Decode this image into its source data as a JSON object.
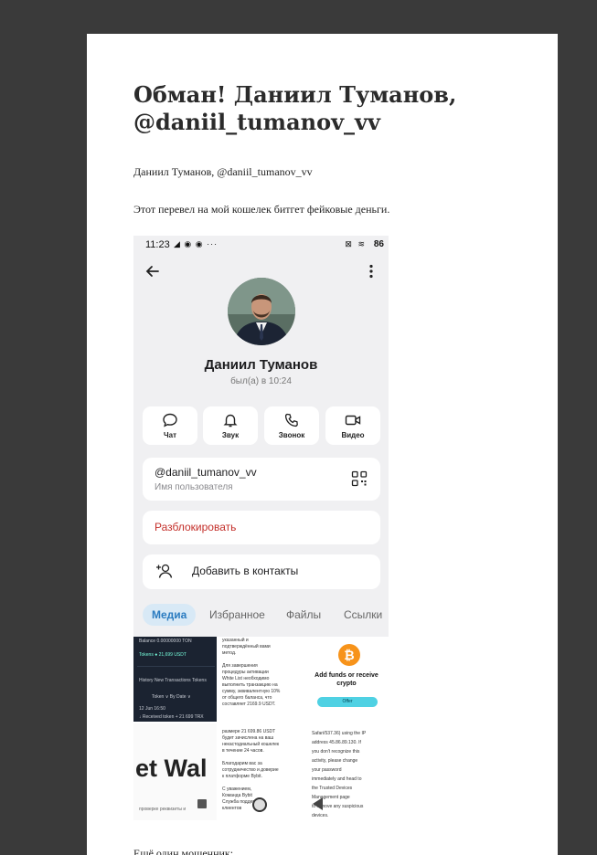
{
  "article": {
    "title": "Обман! Даниил Туманов, @daniil_tumanov_vv",
    "subtitle_line": "Даниил Туманов, @daniil_tumanov_vv",
    "description": "Этот перевел на мой кошелек битгет фейковые деньги.",
    "next_line": "Ещё один мошенник:"
  },
  "screenshot": {
    "status_time": "11:23",
    "status_left_icons": "◢ ◉ ◉ ···",
    "status_right_icons": "⊠ ≋",
    "battery": "86",
    "contact_name": "Даниил Туманов",
    "last_seen": "был(а) в 10:24",
    "actions": [
      {
        "label": "Чат",
        "icon": "chat-icon"
      },
      {
        "label": "Звук",
        "icon": "bell-icon"
      },
      {
        "label": "Звонок",
        "icon": "phone-icon"
      },
      {
        "label": "Видео",
        "icon": "video-icon"
      }
    ],
    "username": "@daniil_tumanov_vv",
    "username_label": "Имя пользователя",
    "unblock_label": "Разблокировать",
    "add_contact_label": "Добавить в контакты",
    "tabs": [
      "Медиа",
      "Избранное",
      "Файлы",
      "Ссылки"
    ],
    "media": {
      "c1_lines": [
        "Balance 0.00000000 TON",
        "Tokens ● 21,699 USDT",
        "History  New Transactions  Tokens",
        "Token ∨   By Date ∨",
        "12 Jun 16:50",
        "↓ Received token  + 21 699 TRX"
      ],
      "c2_lines": [
        "указанный и",
        "подтверждённый вами",
        "метод.",
        "",
        "Для завершения",
        "процедуры активации",
        "White List необходимо",
        "выполнить транзакцию на",
        "сумму, эквивалентную 10%",
        "от общего баланса, что",
        "составляет 2169.9 USDT."
      ],
      "c3_title": "Add funds or receive crypto",
      "c3_button": "Offer",
      "c4_text": "et Wal",
      "c4_foot": "проверке реквизиты и",
      "c5_lines": [
        "размере 21 699.86 USDT",
        "будет зачислена на ваш",
        "некастодиальный кошелек",
        "в течение 24 часов.",
        "",
        "Благодарим вас за",
        "сотрудничество и доверие",
        "к платформе Bybit.",
        "",
        "С уважением,",
        "Команда Bybit",
        "Служба поддержки",
        "клиентов"
      ],
      "c6_lines": [
        "Safari/537.36) using the IP",
        "address 45.86.89.130. If",
        "you don't recognize this",
        "activity, please change",
        "your password",
        "immediately and head to",
        "the Trusted Devices",
        "Management page",
        "to remove any suspicious",
        "devices."
      ]
    }
  }
}
